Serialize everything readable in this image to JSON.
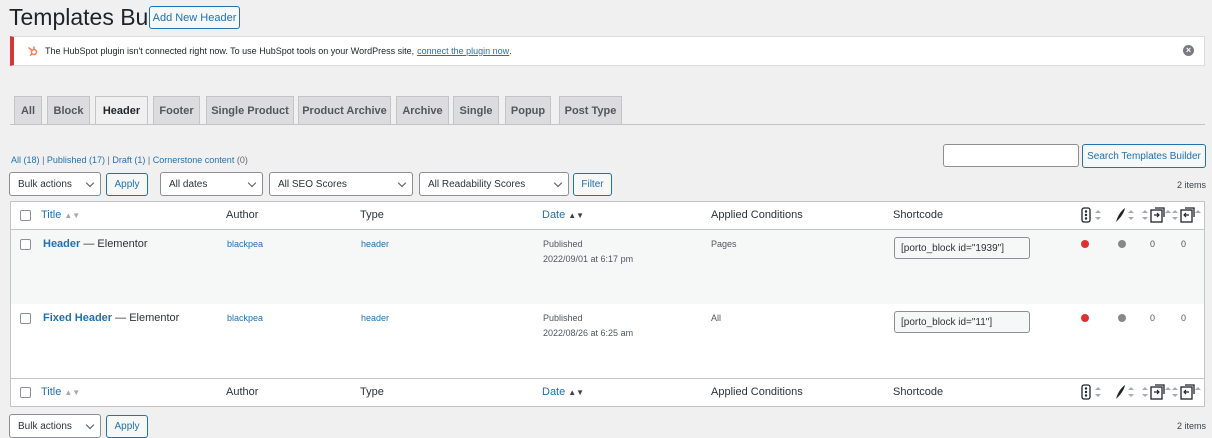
{
  "page": {
    "title": "Templates Builder",
    "add_new": "Add New Header"
  },
  "notice": {
    "text": "The HubSpot plugin isn't connected right now. To use HubSpot tools on your WordPress site,",
    "link": "connect the plugin now",
    "after": ".",
    "close": "×",
    "hubspot_icon": "hubspot-sprocket-icon"
  },
  "tabs": [
    {
      "label": "All"
    },
    {
      "label": "Block"
    },
    {
      "label": "Header"
    },
    {
      "label": "Footer"
    },
    {
      "label": "Single Product"
    },
    {
      "label": "Product Archive"
    },
    {
      "label": "Archive"
    },
    {
      "label": "Single"
    },
    {
      "label": "Popup"
    },
    {
      "label": "Post Type"
    }
  ],
  "subsubsub": {
    "all": "All",
    "all_count": "(18)",
    "published": "Published",
    "published_count": "(17)",
    "draft": "Draft",
    "draft_count": "(1)",
    "cornerstone": "Cornerstone content",
    "cornerstone_count": "(0)",
    "sep": "|"
  },
  "search": {
    "value": "",
    "button": "Search Templates Builder"
  },
  "tablenav_top": {
    "bulk": "Bulk actions",
    "apply": "Apply",
    "dates": "All dates",
    "seo": "All SEO Scores",
    "readability": "All Readability Scores",
    "filter": "Filter",
    "count": "2 items"
  },
  "tablenav_bottom": {
    "bulk": "Bulk actions",
    "apply": "Apply",
    "count": "2 items"
  },
  "columns": {
    "title": "Title",
    "author": "Author",
    "type": "Type",
    "date": "Date",
    "conditions": "Applied Conditions",
    "shortcode": "Shortcode"
  },
  "sort_glyph": "▲▼",
  "rows": [
    {
      "title": "Header",
      "suffix": " — Elementor",
      "author": "blackpea",
      "type": "header",
      "status": "Published",
      "date": "2022/09/01 at 6:17 pm",
      "conditions": "Pages",
      "shortcode": "[porto_block id=\"1939\"]",
      "seo": "0",
      "links": "0",
      "seo_color": "#dc3232",
      "read_color": "#888888"
    },
    {
      "title": "Fixed Header",
      "suffix": " — Elementor",
      "author": "blackpea",
      "type": "header",
      "status": "Published",
      "date": "2022/08/26 at 6:25 am",
      "conditions": "All",
      "shortcode": "[porto_block id=\"11\"]",
      "seo": "0",
      "links": "0",
      "seo_color": "#dc3232",
      "read_color": "#888888"
    }
  ]
}
